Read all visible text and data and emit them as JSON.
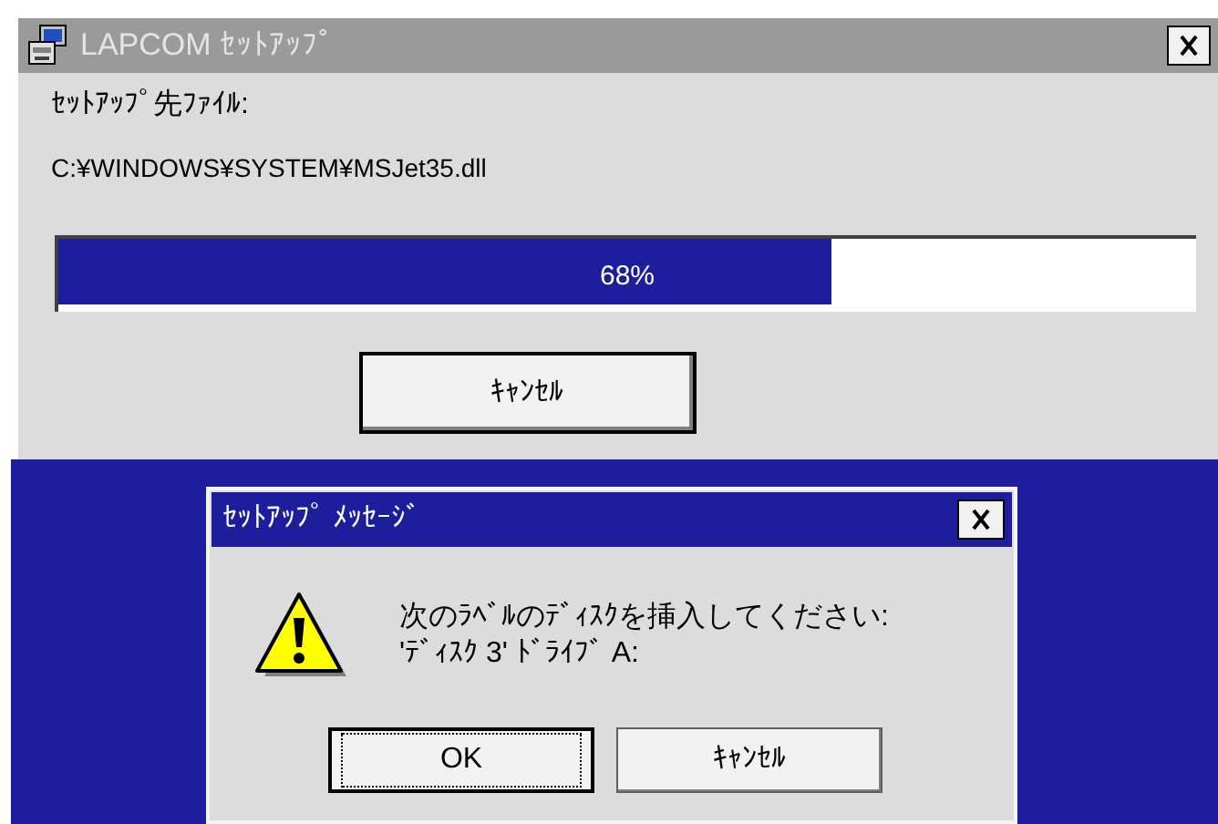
{
  "window": {
    "title": "LAPCOM ｾｯﾄｱｯﾌﾟ",
    "active": false
  },
  "destination_label": "ｾｯﾄｱｯﾌﾟ先ﾌｧｲﾙ:",
  "file_path": "C:¥WINDOWS¥SYSTEM¥MSJet35.dll",
  "progress": {
    "level": 0.68,
    "reading": "68%"
  },
  "cancel_button": "ｷｬﾝｾﾙ",
  "dialog": {
    "title": "ｾｯﾄｱｯﾌﾟ ﾒｯｾｰｼﾞ",
    "active": true,
    "message": [
      "次のﾗﾍﾞﾙのﾃﾞｨｽｸを挿入してください:",
      "'ﾃﾞｨｽｸ 3' ﾄﾞﾗｲﾌﾞ A:"
    ],
    "buttons": [
      {
        "label": "OK",
        "focused": true
      },
      {
        "label": "ｷｬﾝｾﾙ",
        "focused": false
      }
    ]
  }
}
